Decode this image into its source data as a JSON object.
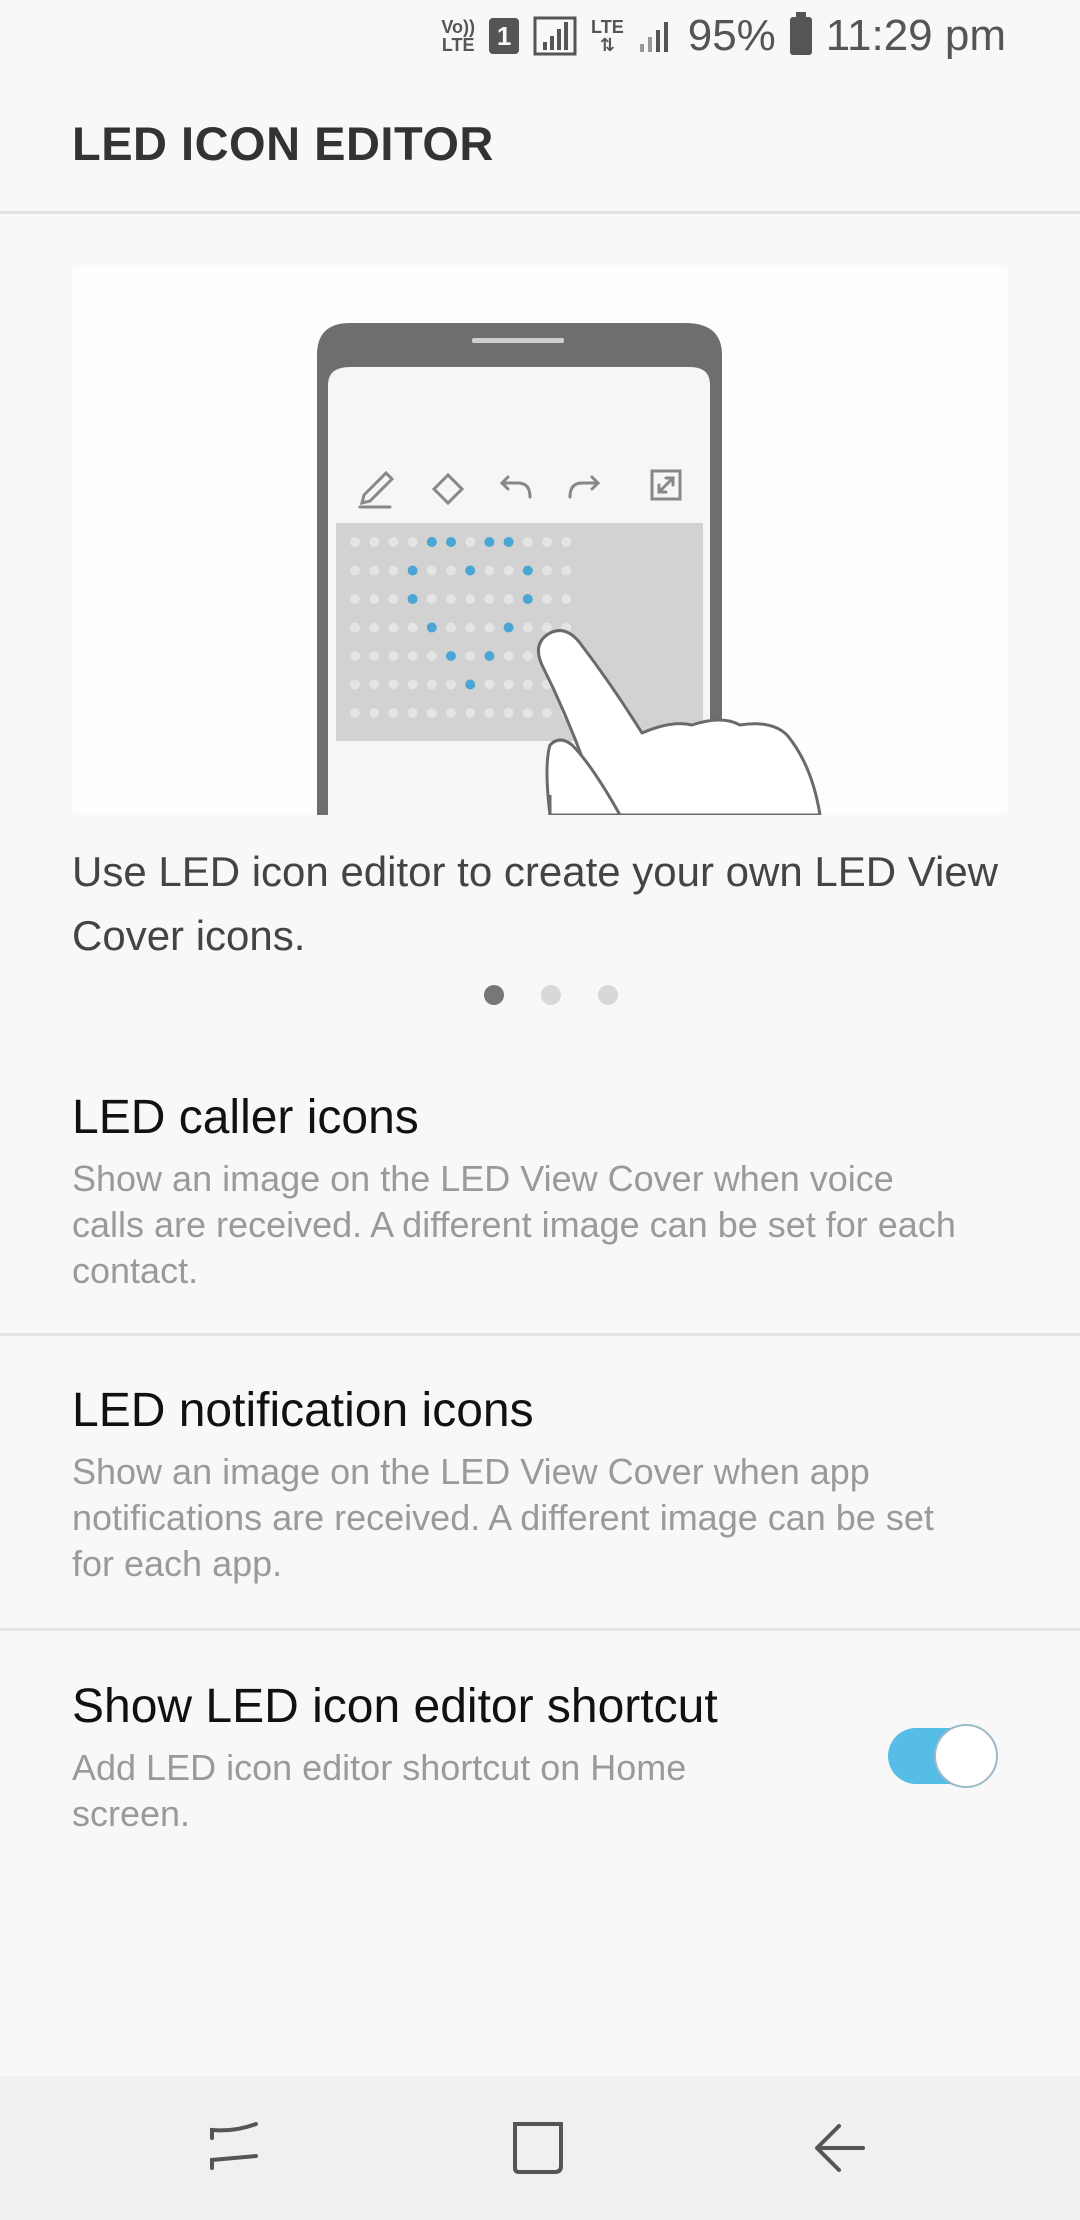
{
  "status_bar": {
    "volte_label": "Vo)) LTE",
    "sim_number": "1",
    "lte_label": "LTE",
    "battery_percent": "95%",
    "time": "11:29 pm"
  },
  "header": {
    "title": "LED ICON EDITOR"
  },
  "intro": {
    "description": "Use LED icon editor to create your own LED View Cover icons.",
    "page_indicator": {
      "total": 3,
      "active_index": 0
    }
  },
  "settings": {
    "caller_icons": {
      "title": "LED caller icons",
      "subtitle": "Show an image on the LED View Cover when voice calls are received. A different image can be set for each contact."
    },
    "notification_icons": {
      "title": "LED notification icons",
      "subtitle": "Show an image on the LED View Cover when app notifications are received. A different image can be set for each app."
    },
    "editor_shortcut": {
      "title": "Show LED icon editor shortcut",
      "subtitle": "Add LED icon editor shortcut on Home screen.",
      "enabled": true
    }
  },
  "nav_bar": {
    "icons": [
      "recent-apps-icon",
      "home-icon",
      "back-icon"
    ]
  },
  "colors": {
    "accent": "#55bde6",
    "led_on": "#4aa6d4",
    "led_off": "#e4e4e4"
  }
}
